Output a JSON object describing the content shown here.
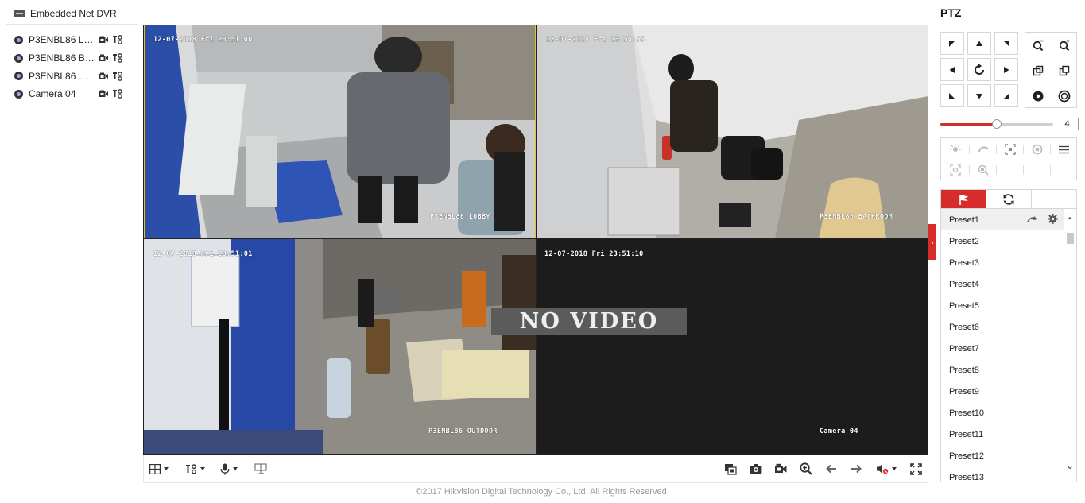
{
  "device_tree": {
    "dvr_label": "Embedded Net DVR",
    "cameras": [
      {
        "label": "P3ENBL86 LO..."
      },
      {
        "label": "P3ENBL86 BA..."
      },
      {
        "label": "P3ENBL86 OU..."
      },
      {
        "label": "Camera 04"
      }
    ]
  },
  "video": {
    "tiles": [
      {
        "timestamp": "12-07-2018 Fri 23:51:00",
        "name": "P3ENBL86 LOBBY",
        "selected": true
      },
      {
        "timestamp": "12-07-2018 Fri 23:50:59",
        "name": "P3ENBL86 BACKROOM"
      },
      {
        "timestamp": "12-07-2018 Fri 23:51:01",
        "name": "P3ENBL86 OUTDOOR"
      },
      {
        "timestamp": "12-07-2018 Fri 23:51:10",
        "name": "Camera 04",
        "no_video_text": "NO VIDEO"
      }
    ]
  },
  "footer": "©2017 Hikvision Digital Technology Co., Ltd. All Rights Reserved.",
  "ptz": {
    "title": "PTZ",
    "speed": "4",
    "speed_fraction": 0.5,
    "presets": [
      "Preset1",
      "Preset2",
      "Preset3",
      "Preset4",
      "Preset5",
      "Preset6",
      "Preset7",
      "Preset8",
      "Preset9",
      "Preset10",
      "Preset11",
      "Preset12",
      "Preset13"
    ]
  },
  "colors": {
    "accent": "#d72c2c",
    "selected_border": "#e8c32a"
  }
}
